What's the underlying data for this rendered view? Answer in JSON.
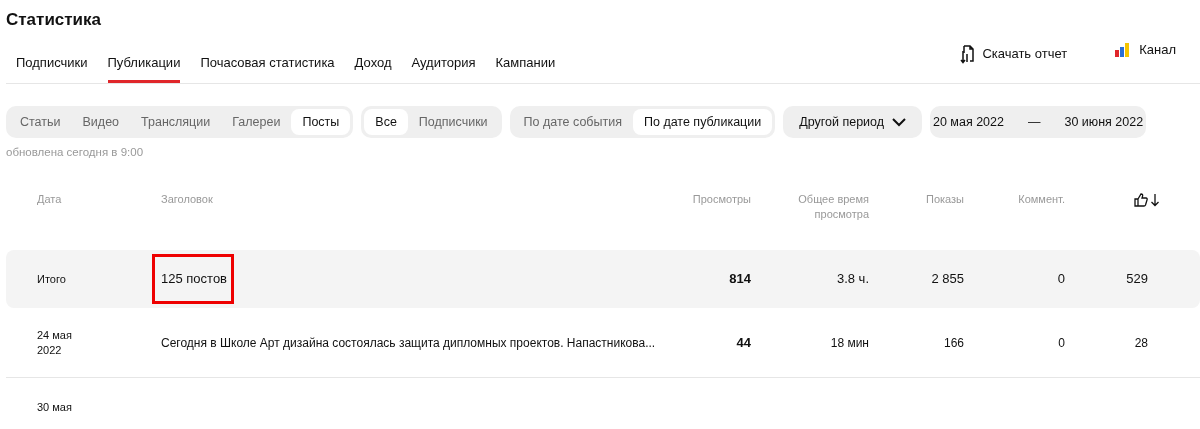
{
  "page_title": "Статистика",
  "tabs": [
    {
      "label": "Подписчики",
      "selected": false
    },
    {
      "label": "Публикации",
      "selected": true
    },
    {
      "label": "Почасовая статистика",
      "selected": false
    },
    {
      "label": "Доход",
      "selected": false
    },
    {
      "label": "Аудитория",
      "selected": false
    },
    {
      "label": "Кампании",
      "selected": false
    }
  ],
  "actions": [
    {
      "label": "Скачать отчет",
      "kind": "download"
    },
    {
      "label": "Канал",
      "kind": "channel"
    }
  ],
  "filter_groups": [
    [
      {
        "label": "Статьи",
        "selected": false
      },
      {
        "label": "Видео",
        "selected": false
      },
      {
        "label": "Трансляции",
        "selected": false
      },
      {
        "label": "Галереи",
        "selected": false
      },
      {
        "label": "Посты",
        "selected": true
      }
    ],
    [
      {
        "label": "Все",
        "selected": true
      },
      {
        "label": "Подписчики",
        "selected": false
      }
    ],
    [
      {
        "label": "По дате события",
        "selected": false
      },
      {
        "label": "По дате публикации",
        "selected": true
      }
    ]
  ],
  "period": {
    "label": "Другой период"
  },
  "date_range": {
    "from": "20 мая 2022",
    "separator": "—",
    "to": "30 июня 2022"
  },
  "updated": "обновлена сегодня в 9:00",
  "table": {
    "columns": [
      "Дата",
      "Заголовок",
      "Просмотры",
      "Общее время просмотра",
      "Показы",
      "Коммент.",
      ""
    ],
    "rows": [
      {
        "kind": "total",
        "date": "Итого",
        "title": "125 постов",
        "highlighted": true,
        "views": "814",
        "time": "3.8 ч.",
        "shows": "2 855",
        "comments": "0",
        "likes": "529"
      },
      {
        "kind": "post",
        "date": "24 мая 2022",
        "title": "Сегодня в Школе Арт дизайна состоялась защита дипломных проектов. Напастникова...",
        "highlighted": false,
        "views": "44",
        "time": "18 мин",
        "shows": "166",
        "comments": "0",
        "likes": "28"
      },
      {
        "kind": "post",
        "date": "30 мая"
      }
    ]
  }
}
